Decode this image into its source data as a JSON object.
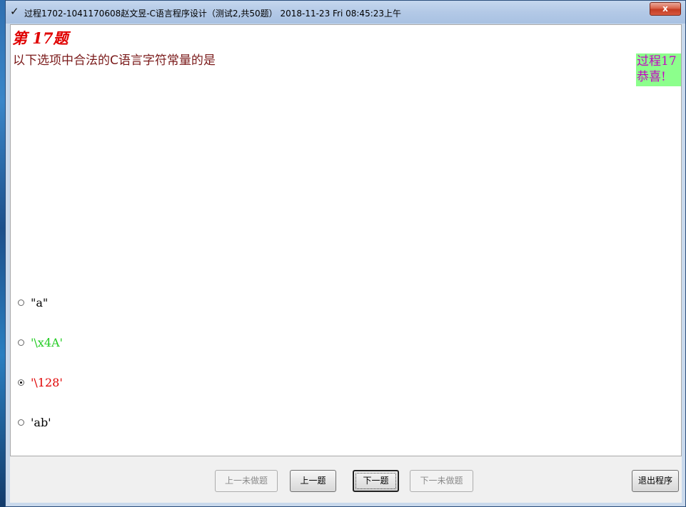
{
  "window": {
    "check_glyph": "✓",
    "title": "过程1702-1041170608赵文昱-C语言程序设计（测试2,共50题） 2018-11-23 Fri 08:45:23上午",
    "close_label": "x"
  },
  "question": {
    "number_label": "第 17题",
    "text": "以下选项中合法的C语言字符常量的是"
  },
  "side_panel": {
    "line1": "过程17",
    "line2": "恭喜!"
  },
  "options": [
    {
      "label": "\"a\"",
      "color": "#000000",
      "selected": false
    },
    {
      "label": "'\\x4A'",
      "color": "#22cc22",
      "selected": false
    },
    {
      "label": "'\\128'",
      "color": "#e00000",
      "selected": true
    },
    {
      "label": "'ab'",
      "color": "#000000",
      "selected": false
    }
  ],
  "buttons": {
    "prev_unanswered": "上一未做题",
    "prev": "上一题",
    "next": "下一题",
    "next_unanswered": "下一未做题",
    "exit": "退出程序"
  }
}
